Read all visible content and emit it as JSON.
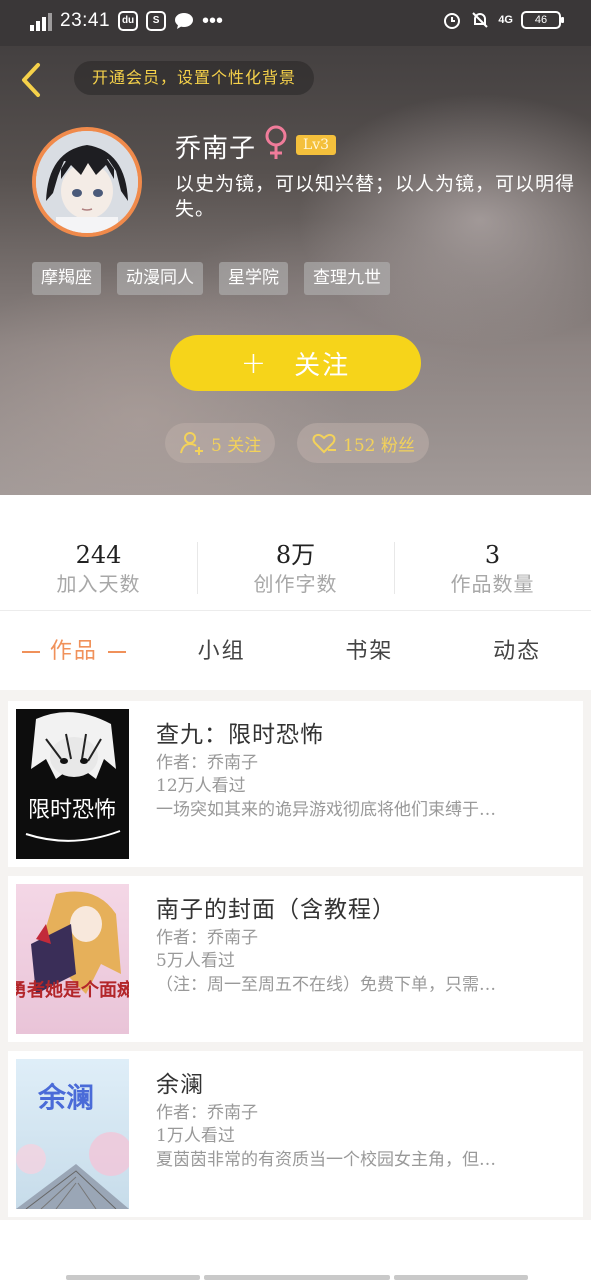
{
  "status_bar": {
    "network": "4G",
    "time": "23:41",
    "app_icons": [
      "du",
      "S"
    ],
    "right_network": "4G",
    "battery": "46"
  },
  "header": {
    "vip_banner": "开通会员，设置个性化背景"
  },
  "profile": {
    "username": "乔南子",
    "gender_symbol": "♀",
    "level": "Lv3",
    "bio": "以史为镜，可以知兴替；以人为镜，可以明得失。",
    "tags": [
      "摩羯座",
      "动漫同人",
      "星学院",
      "查理九世"
    ],
    "follow_plus": "+",
    "follow_label": "关注",
    "following_text": "5 关注",
    "fans_text": "152 粉丝"
  },
  "stats": [
    {
      "value": "244",
      "label": "加入天数"
    },
    {
      "value": "8万",
      "label": "创作字数"
    },
    {
      "value": "3",
      "label": "作品数量"
    }
  ],
  "tabs": [
    {
      "label": "作品",
      "active": true
    },
    {
      "label": "小组",
      "active": false
    },
    {
      "label": "书架",
      "active": false
    },
    {
      "label": "动态",
      "active": false
    }
  ],
  "works": [
    {
      "title": "查九：限时恐怖",
      "author": "作者：乔南子",
      "views": "12万人看过",
      "desc": "一场突如其来的诡异游戏彻底将他们束缚于…",
      "cover_text": "限时恐怖"
    },
    {
      "title": "南子的封面（含教程）",
      "author": "作者：乔南子",
      "views": "5万人看过",
      "desc": "（注：周一至周五不在线）免费下单，只需…",
      "cover_text": "勇者她是个面瘫"
    },
    {
      "title": "余澜",
      "author": "作者：乔南子",
      "views": "1万人看过",
      "desc": "夏茵茵非常的有资质当一个校园女主角，但…",
      "cover_text": "余澜"
    }
  ],
  "colors": {
    "accent_orange": "#f0915a",
    "follow_yellow": "#f6d41a",
    "vip_text": "#f5d14a",
    "level_badge": "#f4c03c"
  }
}
